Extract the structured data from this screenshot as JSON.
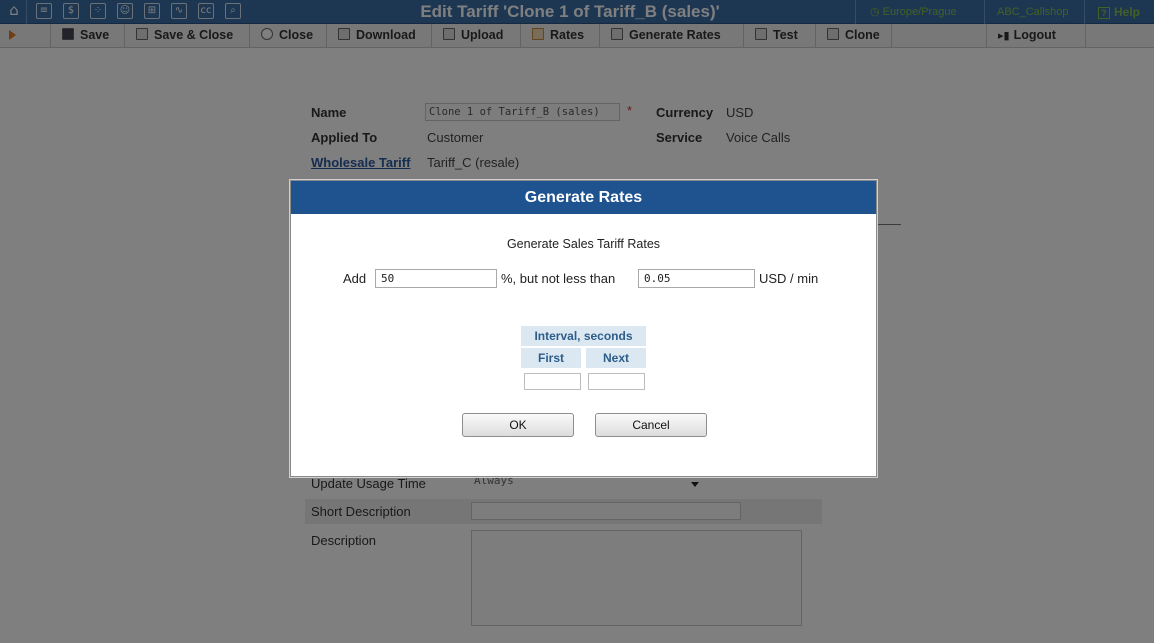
{
  "topbar": {
    "icons": [
      "home-icon",
      "list-icon",
      "dollar-icon",
      "grid-icon",
      "person-icon",
      "nodes-icon",
      "chart-icon",
      "cc-icon",
      "search-icon"
    ],
    "title": "Edit Tariff 'Clone 1 of Tariff_B (sales)'",
    "timezone": "Europe/Prague",
    "account": "ABC_Callshop",
    "help": "Help"
  },
  "toolbar": {
    "save": "Save",
    "save_close": "Save & Close",
    "close": "Close",
    "download": "Download",
    "upload": "Upload",
    "rates": "Rates",
    "generate_rates": "Generate Rates",
    "test": "Test",
    "clone": "Clone",
    "logout": "Logout"
  },
  "form": {
    "name_label": "Name",
    "name_value": "Clone 1 of Tariff_B (sales)",
    "required_mark": "*",
    "currency_label": "Currency",
    "currency_value": "USD",
    "applied_to_label": "Applied To",
    "applied_to_value": "Customer",
    "service_label": "Service",
    "service_value": "Voice Calls",
    "wholesale_label": "Wholesale Tariff",
    "wholesale_value": "Tariff_C (resale)",
    "update_usage_label": "Update Usage Time",
    "update_usage_value": "Always",
    "short_desc_label": "Short Description",
    "desc_label": "Description"
  },
  "dialog": {
    "title": "Generate Rates",
    "subtitle": "Generate Sales Tariff Rates",
    "add_label": "Add",
    "add_value": "50",
    "percent_label": "%,  but not less than",
    "min_value": "0.05",
    "unit_label": "USD / min",
    "interval_header": "Interval, seconds",
    "first_label": "First",
    "next_label": "Next",
    "first_value": "",
    "next_value": "",
    "ok": "OK",
    "cancel": "Cancel"
  },
  "colors": {
    "topbar": "#3a6ea6",
    "dialog_header": "#1f5390",
    "link_green": "#86c04a",
    "interval_header_bg": "#dbe8f2"
  }
}
